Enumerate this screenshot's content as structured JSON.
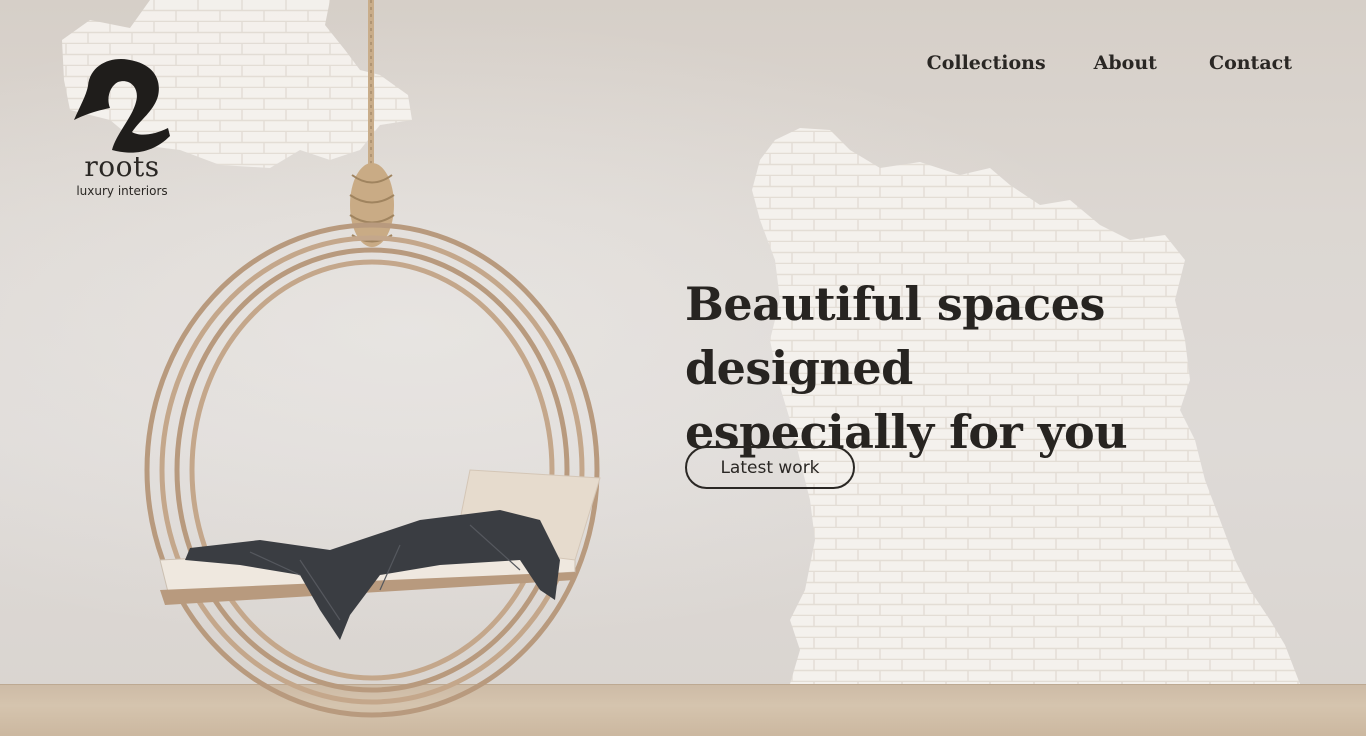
{
  "brand": {
    "mark_icon": "numeral-two-mark",
    "name": "roots",
    "tagline": "luxury interiors"
  },
  "nav": {
    "items": [
      {
        "label": "Collections"
      },
      {
        "label": "About"
      },
      {
        "label": "Contact"
      }
    ]
  },
  "hero": {
    "headline_line1": "Beautiful spaces designed",
    "headline_line2": "especially for you",
    "cta_label": "Latest work"
  },
  "colors": {
    "text": "#2a2724",
    "wall": "#dcd7d2",
    "floor": "#d5c4ae",
    "brick": "#f4f1ec",
    "swing_frame": "#b89a7e"
  }
}
